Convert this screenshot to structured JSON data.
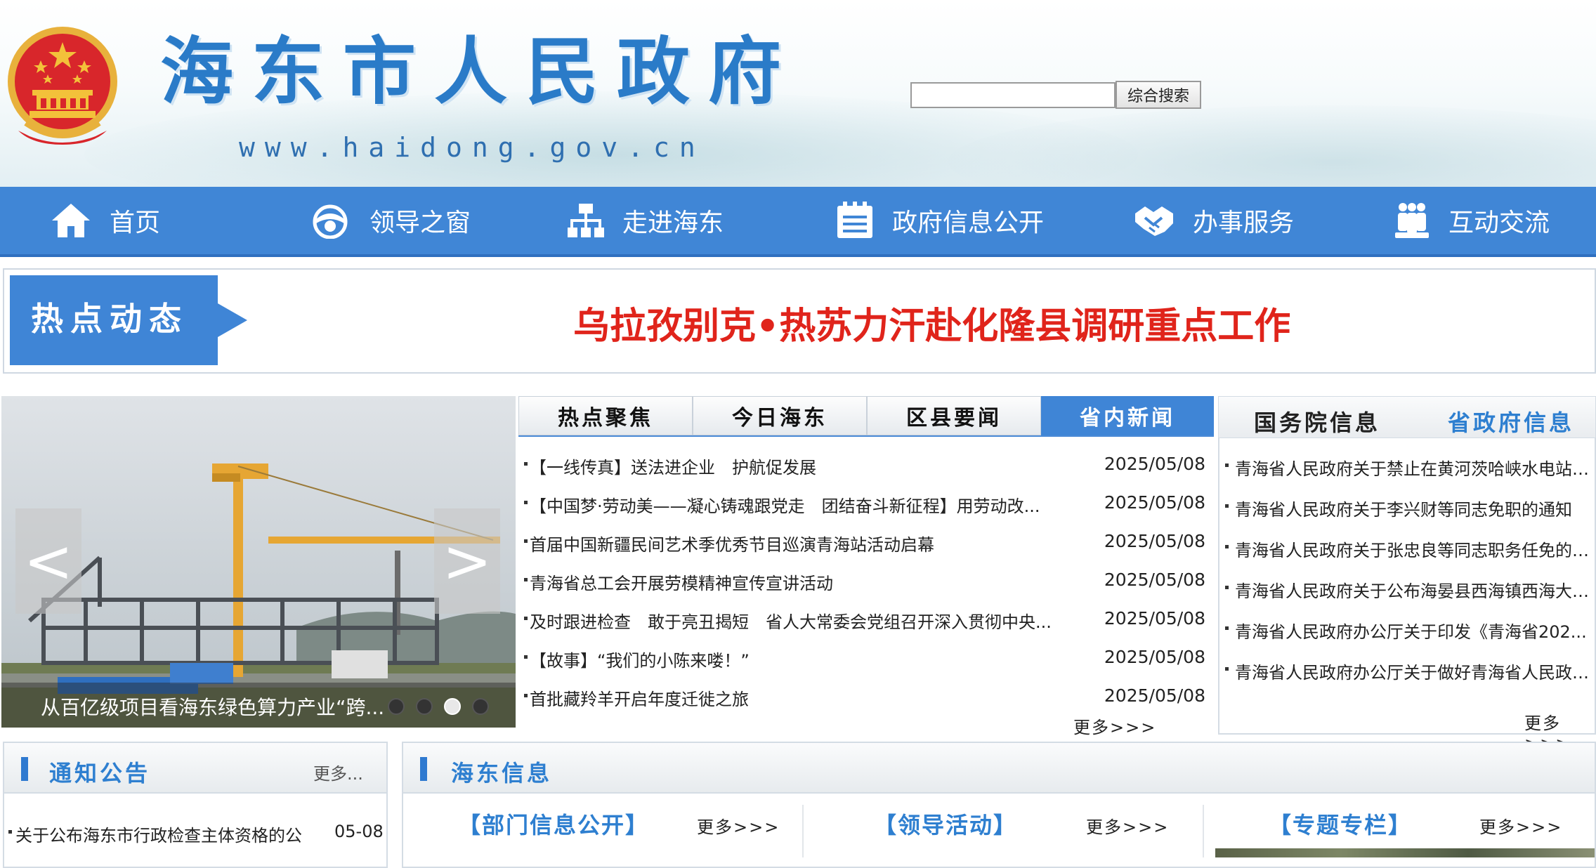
{
  "header": {
    "site_title": "海东市人民政府",
    "site_url": "www.haidong.gov.cn",
    "search_placeholder": "",
    "search_button": "综合搜索"
  },
  "nav": {
    "items": [
      {
        "label": "首页",
        "icon": "home-icon"
      },
      {
        "label": "领导之窗",
        "icon": "leader-icon"
      },
      {
        "label": "走进海东",
        "icon": "org-chart-icon"
      },
      {
        "label": "政府信息公开",
        "icon": "document-icon"
      },
      {
        "label": "办事服务",
        "icon": "handshake-icon"
      },
      {
        "label": "互动交流",
        "icon": "people-icon"
      }
    ]
  },
  "hot": {
    "label": "热点动态",
    "headline": "乌拉孜别克•热苏力汗赴化隆县调研重点工作"
  },
  "carousel": {
    "prev": "<",
    "next": ">",
    "caption": "从百亿级项目看海东绿色算力产业“跨...",
    "slide_count": 4,
    "active_slide": 3
  },
  "news": {
    "tabs": [
      "热点聚焦",
      "今日海东",
      "区县要闻",
      "省内新闻"
    ],
    "active_tab": 3,
    "items": [
      {
        "title": "【一线传真】送法进企业　护航促发展",
        "date": "2025/05/08"
      },
      {
        "title": "【中国梦·劳动美——凝心铸魂跟党走　团结奋斗新征程】用劳动改...",
        "date": "2025/05/08"
      },
      {
        "title": "首届中国新疆民间艺术季优秀节目巡演青海站活动启幕",
        "date": "2025/05/08"
      },
      {
        "title": "青海省总工会开展劳模精神宣传宣讲活动",
        "date": "2025/05/08"
      },
      {
        "title": "及时跟进检查　敢于亮丑揭短　省人大常委会党组召开深入贯彻中央...",
        "date": "2025/05/08"
      },
      {
        "title": "【故事】“我们的小陈来喽！”",
        "date": "2025/05/08"
      },
      {
        "title": "首批藏羚羊开启年度迁徙之旅",
        "date": "2025/05/08"
      }
    ],
    "more": "更多>>>"
  },
  "gov_info": {
    "tabs": [
      "国务院信息",
      "省政府信息"
    ],
    "items": [
      "青海省人民政府关于禁止在黄河茨哈峡水电站工...",
      "青海省人民政府关于李兴财等同志免职的通知",
      "青海省人民政府关于张忠良等同志职务任免的通...",
      "青海省人民政府关于公布海晏县西海镇西海大街...",
      "青海省人民政府办公厅关于印发《青海省202...",
      "青海省人民政府办公厅关于做好青海省人民政府..."
    ],
    "more": "更多>>>"
  },
  "notice": {
    "title": "通知公告",
    "more": "更多...",
    "items": [
      {
        "title": "关于公布海东市行政检查主体资格的公...",
        "date": "05-08"
      }
    ]
  },
  "haidong_info": {
    "title": "海东信息",
    "columns": [
      {
        "title": "【部门信息公开】",
        "more": "更多>>>"
      },
      {
        "title": "【领导活动】",
        "more": "更多>>>"
      },
      {
        "title": "【专题专栏】",
        "more": "更多>>>"
      }
    ]
  },
  "colors": {
    "nav_blue": "#4086d6",
    "headline_red": "#e0241b",
    "title_blue": "#2e7fd0"
  }
}
